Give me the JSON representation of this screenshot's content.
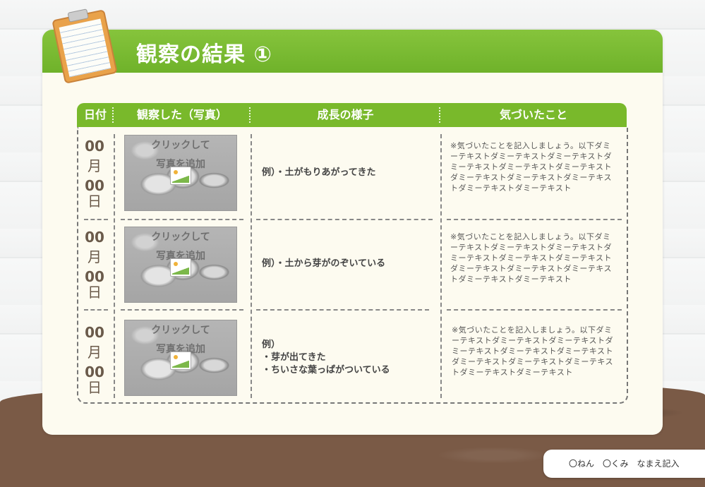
{
  "title": "観察の結果 ①",
  "headers": [
    "日付",
    "観察した（写真）",
    "成長の様子",
    "気づいたこと"
  ],
  "rows": [
    {
      "month_num": "00",
      "month_unit": "月",
      "day_num": "00",
      "day_unit": "日",
      "photo_line1": "クリックして",
      "photo_line2": "写真を追加",
      "growth_lines": [
        "例）・土がもりあがってきた"
      ],
      "notes": "※気づいたことを記入しましょう。以下ダミーテキストダミーテキストダミーテキストダミーテキストダミーテキストダミーテキストダミーテキストダミーテキストダミーテキストダミーテキストダミーテキスト"
    },
    {
      "month_num": "00",
      "month_unit": "月",
      "day_num": "00",
      "day_unit": "日",
      "photo_line1": "クリックして",
      "photo_line2": "写真を追加",
      "growth_lines": [
        "例）・土から芽がのぞいている"
      ],
      "notes": "※気づいたことを記入しましょう。以下ダミーテキストダミーテキストダミーテキストダミーテキストダミーテキストダミーテキストダミーテキストダミーテキストダミーテキストダミーテキストダミーテキスト"
    },
    {
      "month_num": "00",
      "month_unit": "月",
      "day_num": "00",
      "day_unit": "日",
      "photo_line1": "クリックして",
      "photo_line2": "写真を追加",
      "growth_lines": [
        "例）",
        "・芽が出てきた",
        "・ちいさな葉っぱがついている"
      ],
      "notes": "※気づいたことを記入しましょう。以下ダミーテキストダミーテキストダミーテキストダミーテキストダミーテキストダミーテキストダミーテキストダミーテキストダミーテキストダミーテキストダミーテキスト"
    }
  ],
  "footer": {
    "year": "〇ねん",
    "class": "〇くみ",
    "name": "なまえ記入"
  },
  "colors": {
    "header_green": "#79b92b",
    "card_bg": "#fdfbf0",
    "date_brown": "#6a5a4a",
    "soil": "#7a5a46"
  },
  "icons": {
    "clipboard": "clipboard-icon",
    "photo_placeholder": "image-icon"
  }
}
